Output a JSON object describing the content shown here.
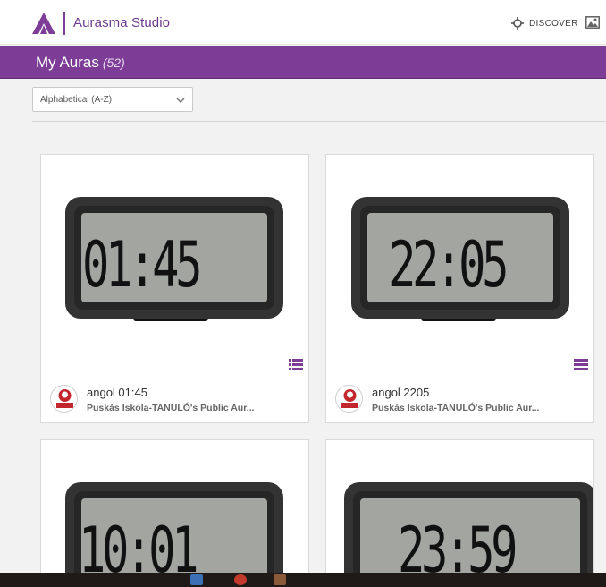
{
  "header": {
    "brand": "Aurasma Studio",
    "discover_label": "DISCOVER",
    "colors": {
      "brand_purple": "#7d3c96"
    }
  },
  "page": {
    "title": "My Auras",
    "count": "(52)"
  },
  "sort": {
    "selected": "Alphabetical (A-Z)"
  },
  "cards": [
    {
      "clock_time": "01:45",
      "name": "angol 01:45",
      "owner": "Puskás Iskola-TANULÓ's Public Aur..."
    },
    {
      "clock_time": "22:05",
      "name": "angol 2205",
      "owner": "Puskás Iskola-TANULÓ's Public Aur..."
    },
    {
      "clock_time": "10:01",
      "name": "",
      "owner": ""
    },
    {
      "clock_time": "23:59",
      "name": "",
      "owner": ""
    }
  ]
}
